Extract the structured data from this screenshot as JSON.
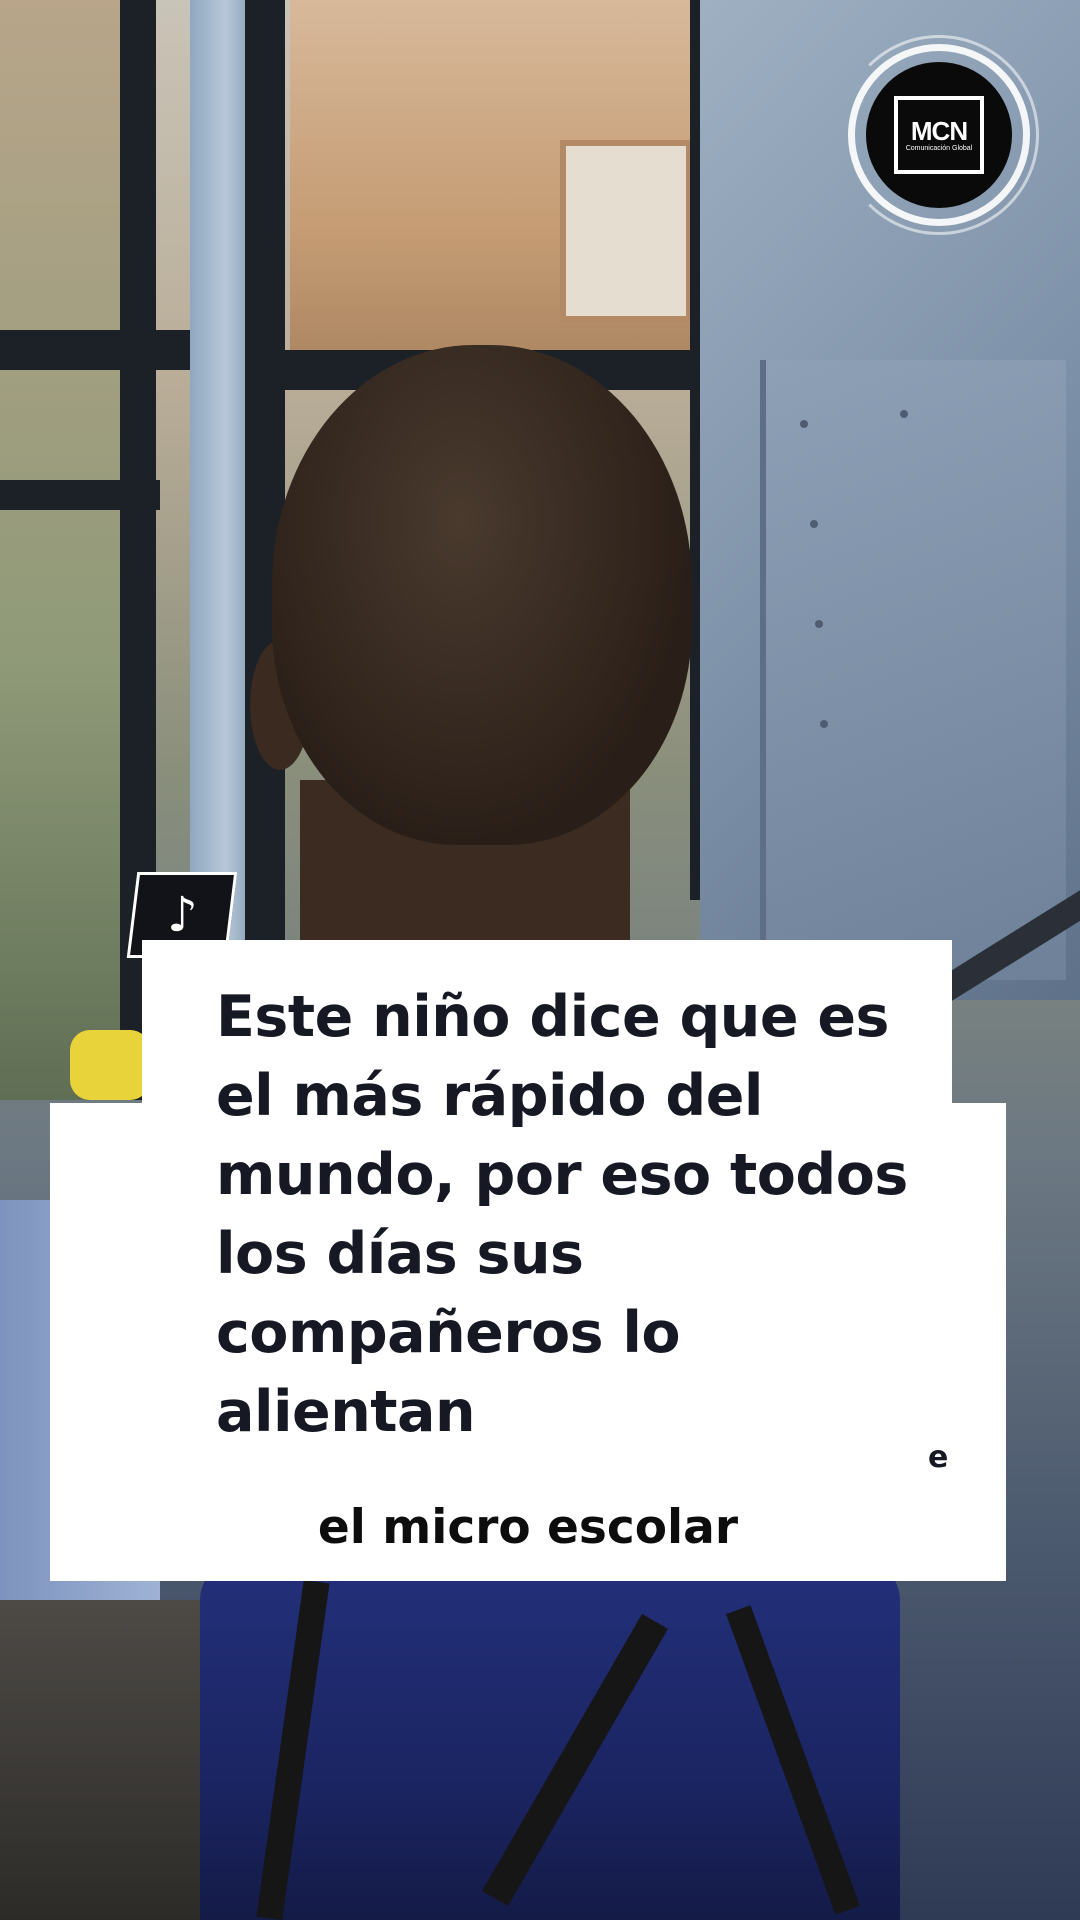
{
  "logo": {
    "main": "MCN",
    "sub": "Comunicación Global"
  },
  "badge": {
    "icon": "tiktok-icon",
    "glyph": "♪"
  },
  "caption": {
    "text": "Este niño dice que es el más rápido del mundo, por eso todos los días sus compañeros lo alientan",
    "stray_char": "e"
  },
  "subtitle": {
    "text": "el micro escolar"
  },
  "colors": {
    "caption_text": "#161823",
    "caption_bg": "#ffffff",
    "badge_bg": "#111318"
  }
}
